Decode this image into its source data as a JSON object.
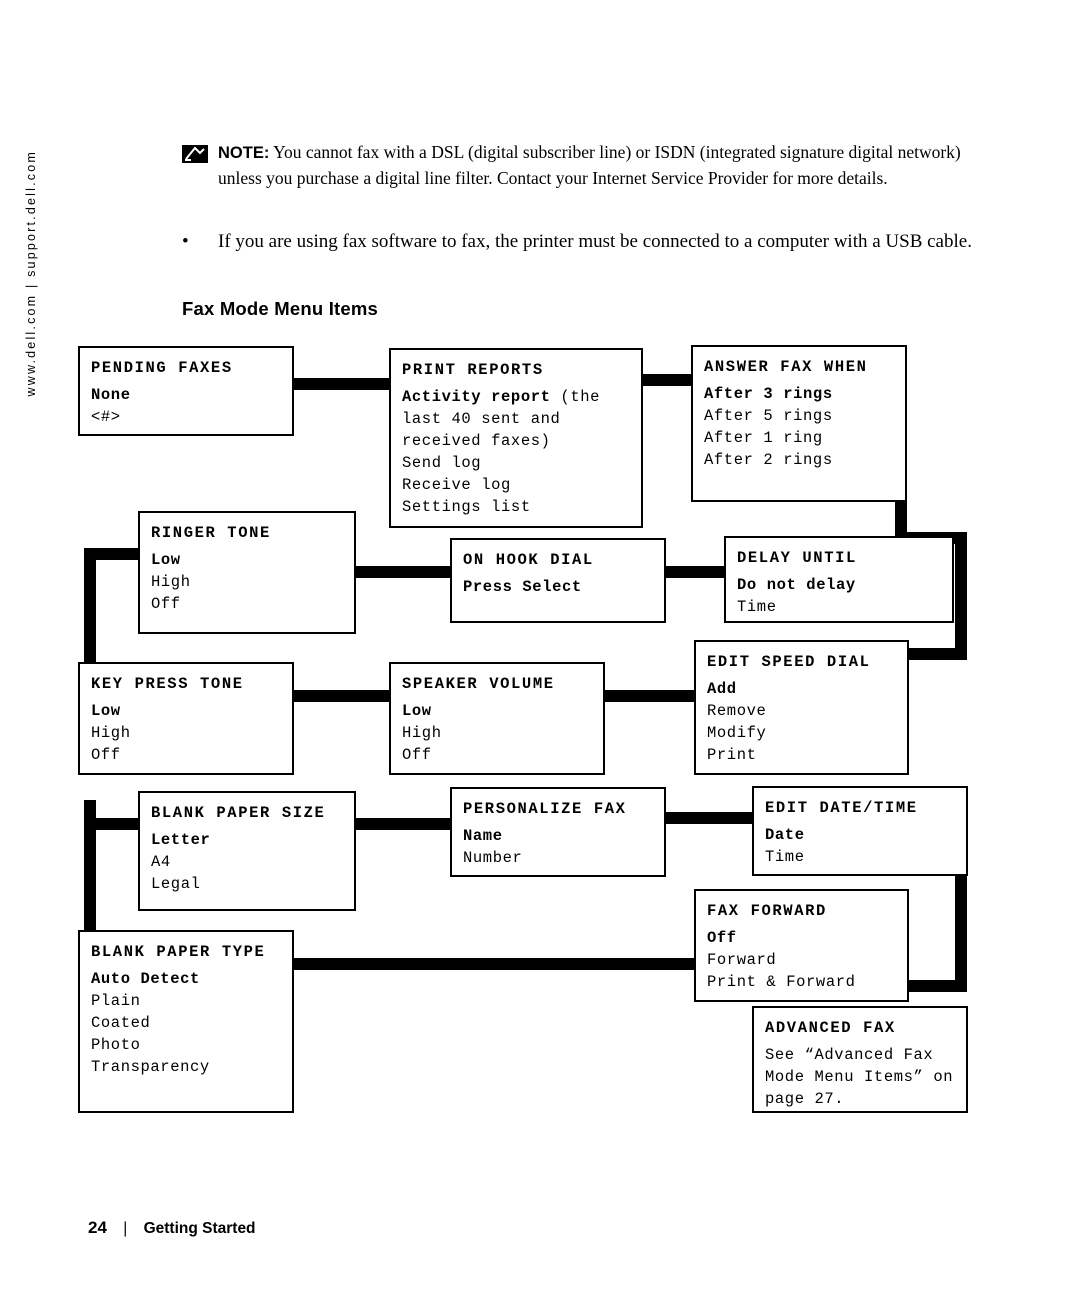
{
  "side_url": "www.dell.com | support.dell.com",
  "note": {
    "label": "NOTE:",
    "text": " You cannot fax with a DSL (digital subscriber line) or ISDN (integrated signature digital network) unless you purchase a digital line filter. Contact your Internet Service Provider for more details."
  },
  "bullet": {
    "marker": "•",
    "text": "If you are using fax software to fax, the printer must be connected to a computer with a USB cable."
  },
  "heading": "Fax Mode Menu Items",
  "boxes": {
    "pending_faxes": {
      "title": "PENDING FAXES",
      "first": "None",
      "options": [
        "<#>"
      ]
    },
    "print_reports": {
      "title": "PRINT REPORTS",
      "first": "Activity report",
      "first_suffix": " (the",
      "cont": [
        "last 40 sent and",
        "received faxes)"
      ],
      "options": [
        "Send log",
        "Receive log",
        "Settings list"
      ]
    },
    "answer_fax_when": {
      "title": "ANSWER FAX WHEN",
      "first": "After 3 rings",
      "options": [
        "After 5 rings",
        "After 1 ring",
        "After 2 rings"
      ]
    },
    "ringer_tone": {
      "title": "RINGER TONE",
      "first": "Low",
      "options": [
        "High",
        "Off"
      ]
    },
    "on_hook_dial": {
      "title": "ON HOOK DIAL",
      "first": "Press Select",
      "options": []
    },
    "delay_until": {
      "title": "DELAY UNTIL",
      "first": "Do not delay",
      "options": [
        "Time"
      ]
    },
    "key_press_tone": {
      "title": "KEY PRESS TONE",
      "first": "Low",
      "options": [
        "High",
        "Off"
      ]
    },
    "speaker_volume": {
      "title": "SPEAKER VOLUME",
      "first": "Low",
      "options": [
        "High",
        "Off"
      ]
    },
    "edit_speed_dial": {
      "title": "EDIT SPEED DIAL",
      "first": "Add",
      "options": [
        "Remove",
        "Modify",
        "Print"
      ]
    },
    "blank_paper_size": {
      "title": "BLANK PAPER SIZE",
      "first": "Letter",
      "options": [
        "A4",
        "Legal"
      ]
    },
    "personalize_fax": {
      "title": "PERSONALIZE FAX",
      "first": "Name",
      "options": [
        "Number"
      ]
    },
    "edit_date_time": {
      "title": "EDIT DATE/TIME",
      "first": "Date",
      "options": [
        "Time"
      ]
    },
    "fax_forward": {
      "title": "FAX FORWARD",
      "first": "Off",
      "options": [
        "Forward",
        "Print & Forward"
      ]
    },
    "blank_paper_type": {
      "title": "BLANK PAPER TYPE",
      "first": "Auto Detect",
      "options": [
        "Plain",
        "Coated",
        "Photo",
        "Transparency"
      ]
    },
    "advanced_fax": {
      "title": "ADVANCED FAX",
      "lines": [
        "See “Advanced Fax",
        "Mode Menu Items” on",
        "page 27."
      ]
    }
  },
  "footer": {
    "page_number": "24",
    "separator": "|",
    "label": "Getting Started"
  }
}
